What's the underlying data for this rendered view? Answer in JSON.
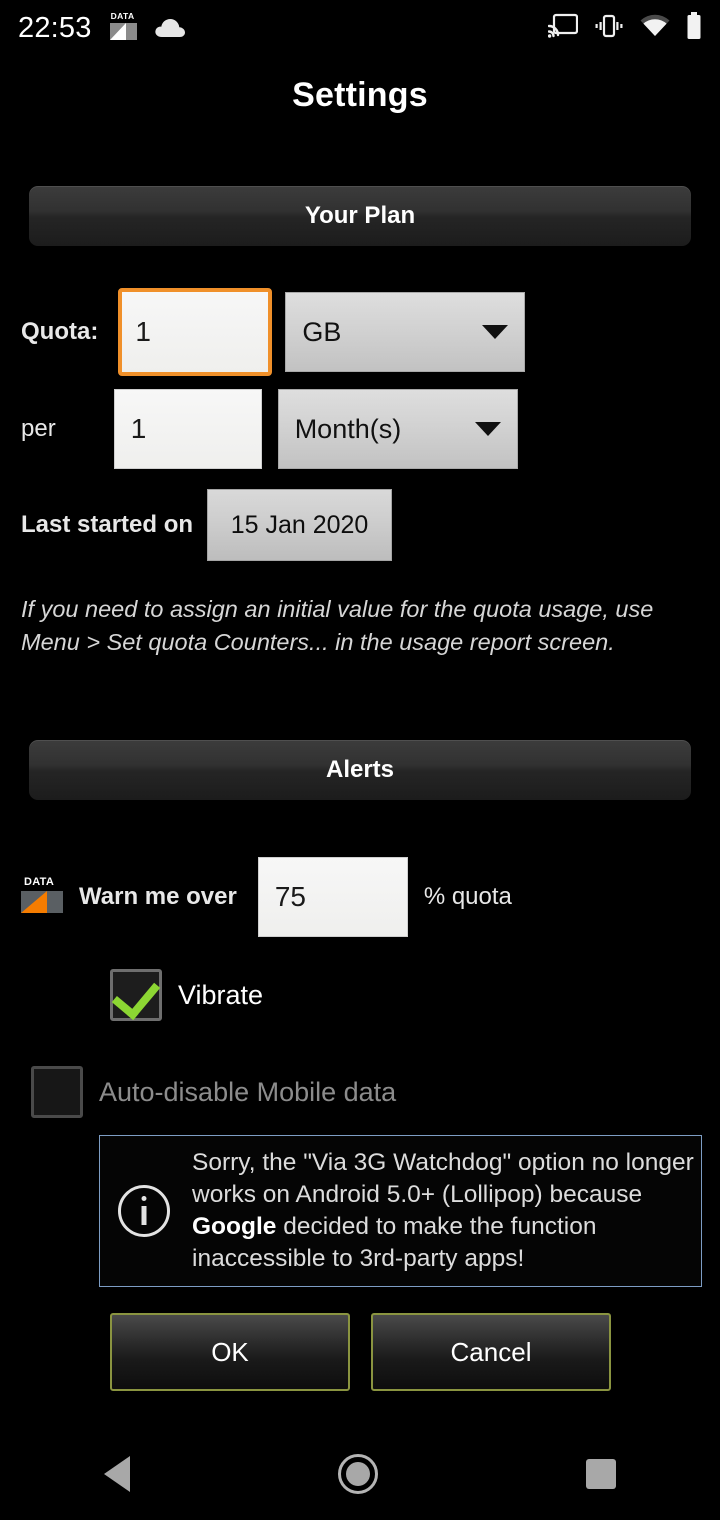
{
  "statusbar": {
    "clock": "22:53",
    "left_icons": [
      {
        "name": "data-usage-icon",
        "label": "DATA"
      },
      {
        "name": "cloud-icon",
        "label": "cloud"
      }
    ],
    "right_icons": [
      {
        "name": "cast-icon",
        "label": "cast"
      },
      {
        "name": "vibrate-icon",
        "label": "vibrate"
      },
      {
        "name": "wifi-icon",
        "label": "wifi"
      },
      {
        "name": "battery-icon",
        "label": "battery"
      }
    ]
  },
  "header": {
    "title": "Settings"
  },
  "sections": {
    "plan": {
      "header": "Your Plan",
      "quota_label": "Quota:",
      "quota_value": "1",
      "quota_unit": "GB",
      "per_label": "per",
      "per_value": "1",
      "per_unit": "Month(s)",
      "last_started_label": "Last started on",
      "last_started_date": "15 Jan 2020",
      "hint": "If you need to assign an initial value for the quota usage, use Menu > Set quota Counters... in the usage report screen."
    },
    "alerts": {
      "header": "Alerts",
      "warn_label": "Warn me over",
      "warn_value": "75",
      "warn_suffix": "% quota",
      "vibrate_label": "Vibrate",
      "vibrate_checked": "true",
      "autodisable_label": "Auto-disable Mobile data",
      "autodisable_checked": "false"
    }
  },
  "dialog": {
    "text_part1": "Sorry, the \"Via 3G Watchdog\" option no longer works on Android 5.0+ (Lollipop) because ",
    "text_bold": "Google",
    "text_part2": " decided to make the function inaccessible to 3rd-party apps!",
    "ok_label": "OK",
    "cancel_label": "Cancel"
  },
  "navbar": {
    "back": "Back",
    "home": "Home",
    "recents": "Recents"
  },
  "colors": {
    "accent_orange": "#f0902a",
    "check_green": "#8cd633",
    "dialog_border": "#7d9dc4",
    "button_border": "#8a9440",
    "data_icon_orange": "#f57c00"
  }
}
